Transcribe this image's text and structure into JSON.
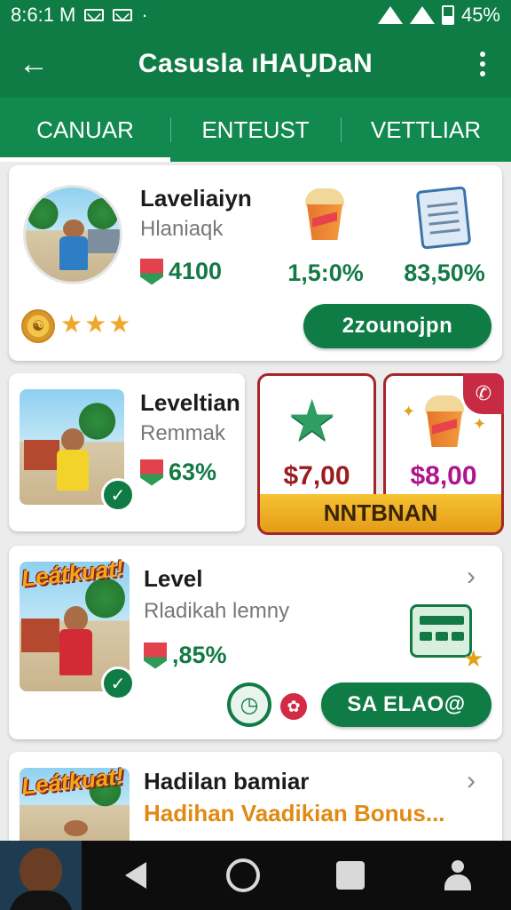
{
  "status_bar": {
    "time": "8:6:1 M",
    "dot": "·",
    "battery": "45%"
  },
  "app_bar": {
    "title": "Casusla ıHAỤDaN",
    "back_icon": "arrow-left-icon",
    "menu_icon": "more-vert-icon"
  },
  "tabs": [
    {
      "label": "CANUAR",
      "active": true
    },
    {
      "label": "ENTEUST",
      "active": false
    },
    {
      "label": "VETTLIAR",
      "active": false
    }
  ],
  "card1": {
    "name": "Laveliaiyn",
    "subtitle": "Hlaniaqk",
    "score": "4100",
    "stat_cup": "1,5:0%",
    "stat_doc": "83,50%",
    "rating_stars": 3,
    "stars_text": "★★★",
    "button": "2zounojpn"
  },
  "card2": {
    "name": "Leveltian",
    "subtitle": "Remmak",
    "percent": "63%",
    "offer_left_price": "$7,00",
    "offer_right_price": "$8,00",
    "offer_banner": "NNTBNAN",
    "price_left_color": "#9a1c22",
    "price_right_color": "#b0148a"
  },
  "card3": {
    "sticker": "Leátkuat!",
    "name": "Level",
    "subtitle": "Rladikah lemny",
    "percent": ",85%",
    "button": "SA ELAO@"
  },
  "card4": {
    "sticker": "Leátkuat!",
    "name": "Hadilan bamiar",
    "subtitle": "Hadihan Vaadikian Bonus..."
  },
  "colors": {
    "brand_green": "#0f7c46",
    "accent_gold": "#f0a62a",
    "offer_border": "#a5262b"
  }
}
